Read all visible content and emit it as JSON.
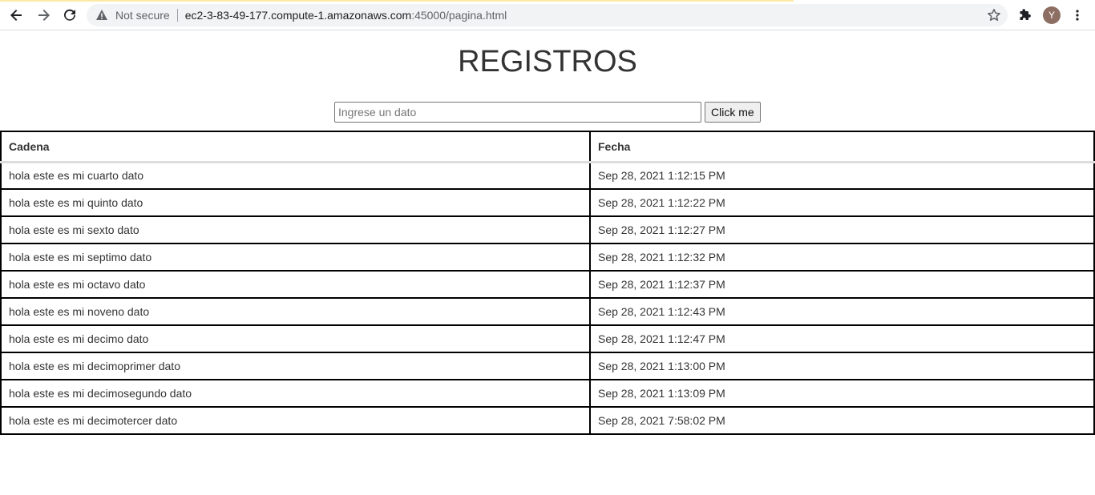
{
  "browser": {
    "security_label": "Not secure",
    "url_host": "ec2-3-83-49-177.compute-1.amazonaws.com",
    "url_rest": ":45000/pagina.html",
    "avatar_initial": "Y"
  },
  "page": {
    "title": "REGISTROS",
    "input_placeholder": "Ingrese un dato",
    "button_label": "Click me"
  },
  "table": {
    "headers": [
      "Cadena",
      "Fecha"
    ],
    "rows": [
      {
        "cadena": "hola este es mi cuarto dato",
        "fecha": "Sep 28, 2021 1:12:15 PM"
      },
      {
        "cadena": "hola este es mi quinto dato",
        "fecha": "Sep 28, 2021 1:12:22 PM"
      },
      {
        "cadena": "hola este es mi sexto dato",
        "fecha": "Sep 28, 2021 1:12:27 PM"
      },
      {
        "cadena": "hola este es mi septimo dato",
        "fecha": "Sep 28, 2021 1:12:32 PM"
      },
      {
        "cadena": "hola este es mi octavo dato",
        "fecha": "Sep 28, 2021 1:12:37 PM"
      },
      {
        "cadena": "hola este es mi noveno dato",
        "fecha": "Sep 28, 2021 1:12:43 PM"
      },
      {
        "cadena": "hola este es mi decimo dato",
        "fecha": "Sep 28, 2021 1:12:47 PM"
      },
      {
        "cadena": "hola este es mi decimoprimer dato",
        "fecha": "Sep 28, 2021 1:13:00 PM"
      },
      {
        "cadena": "hola este es mi decimosegundo dato",
        "fecha": "Sep 28, 2021 1:13:09 PM"
      },
      {
        "cadena": "hola este es mi decimotercer dato",
        "fecha": "Sep 28, 2021 7:58:02 PM"
      }
    ]
  },
  "icons": {
    "back": "arrow-left-icon",
    "forward": "arrow-right-icon",
    "reload": "reload-icon",
    "warning": "warning-triangle-icon",
    "bookmark": "star-icon",
    "extensions": "puzzle-icon",
    "menu": "kebab-menu-icon"
  }
}
